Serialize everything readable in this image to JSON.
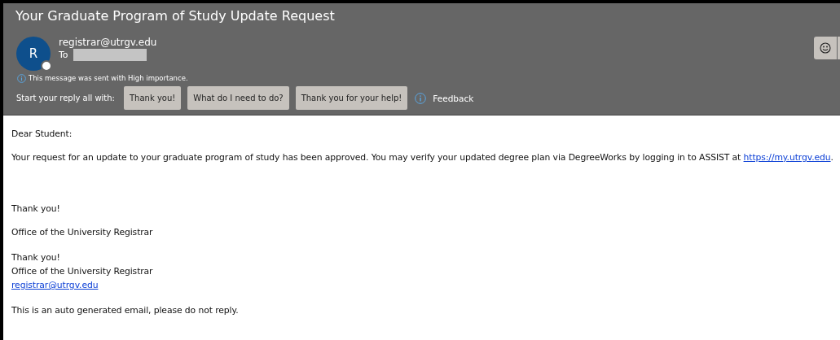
{
  "header": {
    "subject": "Your Graduate Program of Study Update Request",
    "avatar_initial": "R",
    "sender": "registrar@utrgv.edu",
    "to_label": "To",
    "importance_note": "This message was sent with High importance.",
    "reply_prompt": "Start your reply all with:",
    "suggested_replies": [
      "Thank you!",
      "What do I need to do?",
      "Thank you for your help!"
    ],
    "feedback": "Feedback"
  },
  "body": [
    {
      "kind": "text",
      "text": "Dear Student:"
    },
    {
      "kind": "text_link",
      "text": "Your request for an update to your graduate program of study has been approved. You may verify your updated degree plan via DegreeWorks by logging in to ASSIST at ",
      "link": "https://my.utrgv.edu",
      "after": "."
    },
    {
      "kind": "gap"
    },
    {
      "kind": "text",
      "text": "Thank you!"
    },
    {
      "kind": "text",
      "text": "Office of the University Registrar"
    },
    {
      "kind": "lines",
      "lines": [
        {
          "kind": "text",
          "text": "Thank you!"
        },
        {
          "kind": "text",
          "text": "Office of the University Registrar"
        },
        {
          "kind": "link",
          "text": "registrar@utrgv.edu"
        }
      ]
    },
    {
      "kind": "text",
      "text": "This is an auto generated email, please do not reply."
    }
  ]
}
